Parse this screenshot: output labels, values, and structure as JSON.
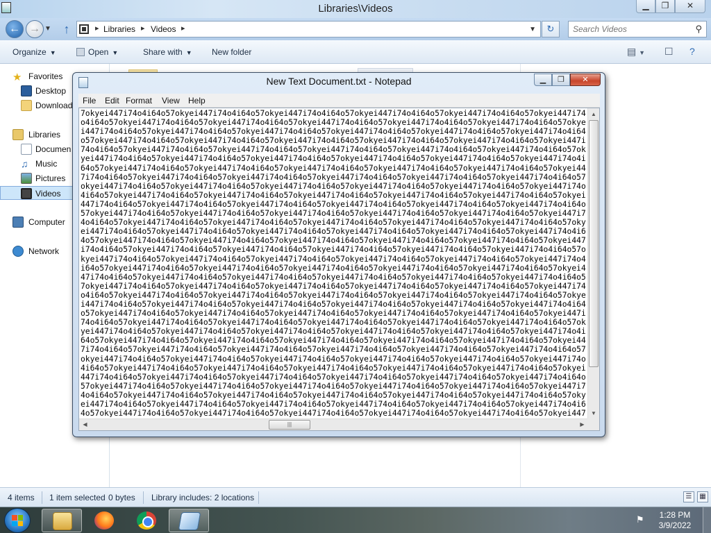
{
  "explorer": {
    "title": "Libraries\\Videos",
    "breadcrumb": [
      "Libraries",
      "Videos"
    ],
    "search_placeholder": "Search Videos",
    "toolbar": {
      "organize": "Organize",
      "open": "Open",
      "share_with": "Share with",
      "new_folder": "New folder"
    },
    "nav": {
      "favorites": "Favorites",
      "desktop": "Desktop",
      "downloads": "Download",
      "libraries": "Libraries",
      "documents": "Documen",
      "music": "Music",
      "pictures": "Pictures",
      "videos": "Videos",
      "computer": "Computer",
      "network": "Network"
    },
    "status": {
      "items": "4 items",
      "selected": "1 item selected",
      "size": "0 bytes",
      "library": "Library includes: 2 locations"
    }
  },
  "notepad": {
    "title": "New Text Document.txt - Notepad",
    "menu": [
      "File",
      "Edit",
      "Format",
      "View",
      "Help"
    ],
    "content_repeat_unit": "okyei447i74o4i64o57",
    "content_prefix": "7",
    "content_repeat_count": 282,
    "content_suffix": "74o4i64o57okyei447i74o4i64o57o",
    "content": ""
  },
  "taskbar": {
    "time": "1:28 PM",
    "date": "3/9/2022"
  },
  "colors": {
    "accent": "#2a78c6",
    "selection": "#cde6fa",
    "close_button": "#c8452b"
  },
  "icons": {
    "back": "back-arrow-icon",
    "forward": "forward-arrow-icon",
    "up": "up-arrow-icon",
    "refresh": "refresh-icon",
    "search": "search-icon",
    "start": "windows-start-icon",
    "folder": "folder-icon",
    "firefox": "firefox-icon",
    "chrome": "chrome-icon",
    "notepad": "notepad-icon"
  }
}
